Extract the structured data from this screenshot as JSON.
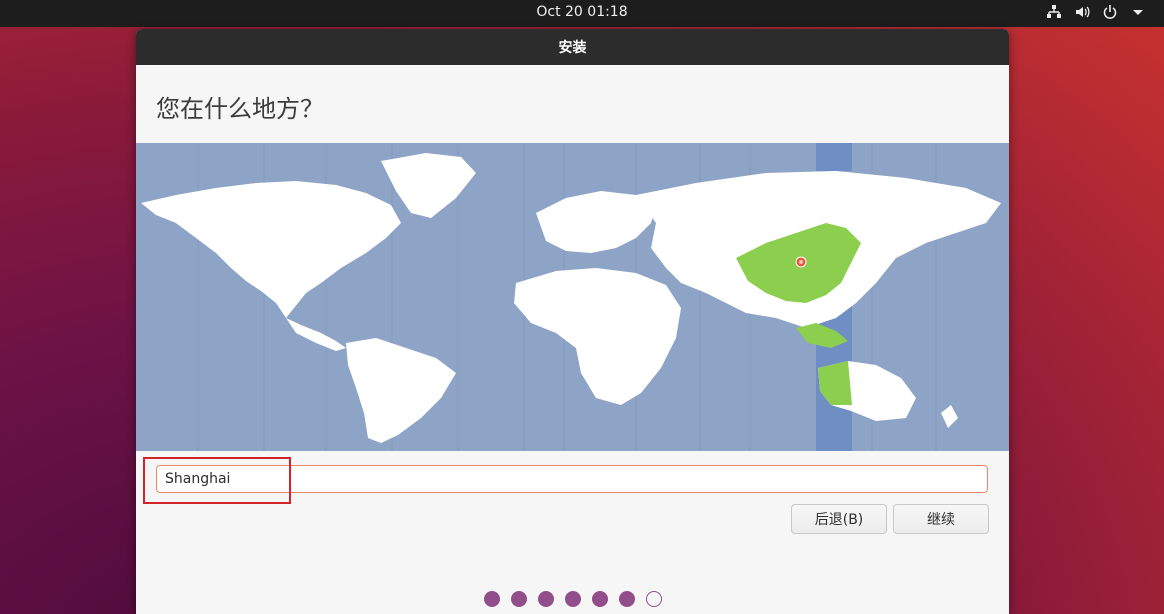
{
  "topbar": {
    "clock": "Oct 20  01:18",
    "icons": [
      "network-icon",
      "volume-icon",
      "power-icon",
      "menu-arrow-icon"
    ]
  },
  "window": {
    "title": "安装",
    "heading": "您在什么地方？",
    "location_input": {
      "value": "Shanghai"
    },
    "buttons": {
      "back": "后退(B)",
      "continue": "继续"
    },
    "progress": {
      "total_steps": 7,
      "current_step": 7
    }
  },
  "map": {
    "selected_timezone_color": "#8ccf4f",
    "highlight_band_color": "#6f8fc4",
    "ocean_color": "#8ea4c7",
    "land_color": "#ffffff",
    "pin": "location-pin-icon"
  },
  "colors": {
    "accent_purple": "#924d8b",
    "focus_orange": "#e9856b",
    "annotation_red": "#d0242a"
  }
}
